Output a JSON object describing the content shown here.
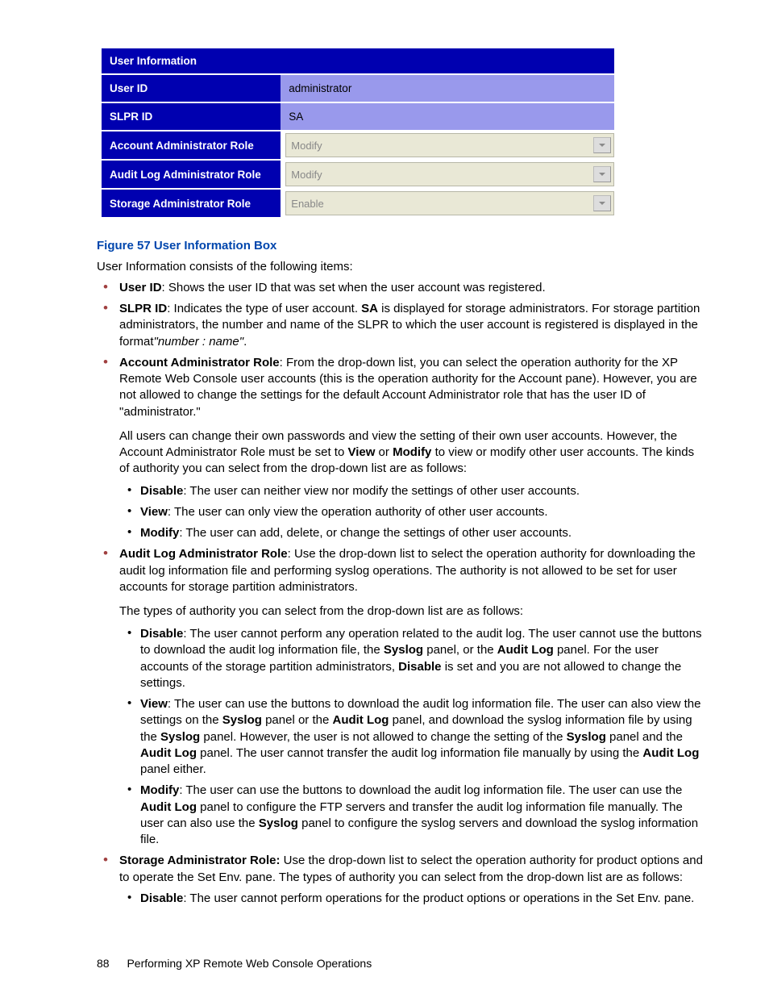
{
  "ui_table": {
    "header": "User Information",
    "rows": {
      "user_id": {
        "label": "User ID",
        "value": "administrator"
      },
      "slpr_id": {
        "label": "SLPR ID",
        "value": "SA"
      },
      "acct_role": {
        "label": "Account Administrator Role",
        "value": "Modify"
      },
      "audit_role": {
        "label": "Audit Log Administrator Role",
        "value": "Modify"
      },
      "storage_role": {
        "label": "Storage Administrator Role",
        "value": "Enable"
      }
    }
  },
  "figure_title": "Figure 57 User Information Box",
  "intro": "User Information consists of the following items:",
  "bullets": {
    "user_id": {
      "term": "User ID",
      "rest": ": Shows the user ID that was set when the user account was registered."
    },
    "slpr_id": {
      "term": "SLPR ID",
      "rest_a": ": Indicates the type of user account.  ",
      "sa": "SA",
      "rest_b": " is displayed for storage administrators.  For storage partition administrators, the number and name of the SLPR to which the user account is registered is displayed in the format",
      "format": "\"number : name\"",
      "dot": "."
    },
    "acct": {
      "term": "Account Administrator Role",
      "rest": ":  From the drop-down list, you can select the operation authority for the XP Remote Web Console user accounts (this is the operation authority for the Account pane).  However, you are not allowed to change the settings for the default Account Administrator role that has the user ID of \"administrator.\"",
      "para_a": "All users can change their own passwords and view the setting of their own user accounts.  However, the Account Administrator Role must be set to ",
      "view": "View",
      "or": " or ",
      "mod": "Modify",
      "para_b": " to view or modify other user accounts.  The kinds of authority you can select from the drop-down list are as follows:",
      "sub": {
        "disable": {
          "term": "Disable",
          "rest": ":  The user can neither view nor modify the settings of other user accounts."
        },
        "view": {
          "term": "View",
          "rest": ":  The user can only view the operation authority of other user accounts."
        },
        "modify": {
          "term": "Modify",
          "rest": ":  The user can add, delete, or change the settings of other user accounts."
        }
      }
    },
    "audit": {
      "term": "Audit Log Administrator Role",
      "rest": ":  Use the drop-down list to select the operation authority for downloading the audit log information file and performing syslog operations.  The authority is not allowed to be set for user accounts for storage partition administrators.",
      "para": "The types of authority you can select from the drop-down list are as follows:",
      "sub": {
        "disable": {
          "term": "Disable",
          "a": ":  The user cannot perform any operation related to the audit log.  The user cannot use the buttons to download the audit log information file, the ",
          "syslog": "Syslog",
          "b": " panel, or the ",
          "auditlog": "Audit Log",
          "c": " panel.  For the user accounts of the storage partition administrators, ",
          "disable2": "Disable",
          "d": " is set and you are not allowed to change the settings."
        },
        "view": {
          "term": "View",
          "a": ":  The user can use the buttons to download the audit log information file.  The user can also view the settings on the ",
          "syslog1": "Syslog",
          "b": " panel or the ",
          "auditlog1": "Audit Log",
          "c": " panel, and download the syslog information file by using the ",
          "syslog2": "Syslog",
          "d": " panel.  However, the user is not allowed to change the setting of the ",
          "syslog3": "Syslog",
          "e": " panel and the ",
          "auditlog2": "Audit Log",
          "f": " panel.  The user cannot transfer the audit log information file manually by using the ",
          "auditlog3": "Audit Log",
          "g": " panel either."
        },
        "modify": {
          "term": "Modify",
          "a": ":  The user can use the buttons to download the audit log information file.  The user can use the ",
          "auditlog": "Audit Log",
          "b": " panel to configure the FTP servers and transfer the audit log information file manually.  The user can also use the ",
          "syslog": "Syslog",
          "c": " panel to configure the syslog servers and download the syslog information file."
        }
      }
    },
    "storage": {
      "term": "Storage Administrator Role:",
      "rest": "  Use the drop-down list to select the operation authority for product options and to operate the Set Env.  pane.  The types of authority you can select from the drop-down list are as follows:",
      "sub": {
        "disable": {
          "term": "Disable",
          "rest": ":  The user cannot perform operations for the product options or operations in the Set Env.  pane."
        }
      }
    }
  },
  "footer": {
    "page": "88",
    "section": "Performing XP Remote Web Console Operations"
  }
}
